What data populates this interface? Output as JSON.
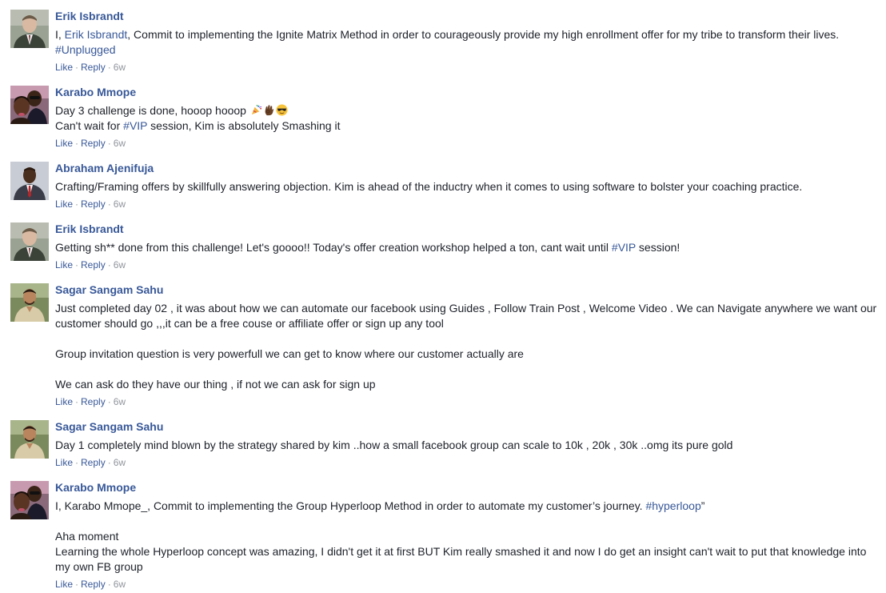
{
  "comments": [
    {
      "author": "Erik Isbrandt",
      "avatar": "avatar-man-suit-green",
      "text_pre": "I, ",
      "mention": "Erik Isbrandt",
      "text_post": ", Commit to implementing the Ignite Matrix Method in order to courageously provide my high enrollment offer for my tribe to transform their lives.",
      "hashtag": "#Unplugged",
      "like": "Like",
      "reply": "Reply",
      "time": "6w"
    },
    {
      "author": "Karabo Mmope",
      "avatar": "avatar-two-people-selfie",
      "line1": "Day 3 challenge is done, hooop hooop",
      "emojis": [
        "party-popper-emoji",
        "ok-hand-emoji",
        "sunglasses-emoji"
      ],
      "line2_pre": "Can't wait for ",
      "hashtag": "#VIP",
      "line2_post": " session, Kim is absolutely Smashing it",
      "like": "Like",
      "reply": "Reply",
      "time": "6w"
    },
    {
      "author": "Abraham Ajenifuja",
      "avatar": "avatar-man-suit-red-tie",
      "text": "Crafting/Framing offers by skillfully answering objection. Kim is ahead of the inductry when it comes to using software to bolster your coaching practice.",
      "like": "Like",
      "reply": "Reply",
      "time": "6w"
    },
    {
      "author": "Erik Isbrandt",
      "avatar": "avatar-man-suit-green",
      "text_pre": "Getting sh** done from this challenge! Let's goooo!! Today's offer creation workshop helped a ton, cant wait until ",
      "hashtag": "#VIP",
      "text_post": " session!",
      "like": "Like",
      "reply": "Reply",
      "time": "6w"
    },
    {
      "author": "Sagar Sangam Sahu",
      "avatar": "avatar-man-outdoors",
      "para1": "Just completed day 02 , it was about how we can automate our facebook using Guides , Follow Train Post , Welcome Video . We can Navigate anywhere we want our customer should go ,,,it can be a free couse or affiliate offer or sign up any tool",
      "para2": "Group invitation question is very powerfull we can get to know where our customer actually are",
      "para3": "We can ask do they have our thing , if not we can ask for sign up",
      "like": "Like",
      "reply": "Reply",
      "time": "6w"
    },
    {
      "author": "Sagar Sangam Sahu",
      "avatar": "avatar-man-outdoors",
      "text": "Day 1 completely mind blown by the strategy shared by kim ..how a small facebook group can scale to 10k , 20k , 30k ..omg its pure gold",
      "like": "Like",
      "reply": "Reply",
      "time": "6w"
    },
    {
      "author": "Karabo Mmope",
      "avatar": "avatar-two-people-selfie",
      "para1_pre": "I, Karabo Mmope_, Commit to implementing the Group Hyperloop Method in order to automate my customer’s journey. ",
      "hashtag": "#hyperloop",
      "para1_post": "”",
      "para2": "Aha moment",
      "para3": "Learning the whole Hyperloop concept was amazing, I didn't get it at first BUT Kim really smashed it and now I do get an insight can't wait to put that knowledge into my own FB group",
      "like": "Like",
      "reply": "Reply",
      "time": "6w"
    }
  ]
}
